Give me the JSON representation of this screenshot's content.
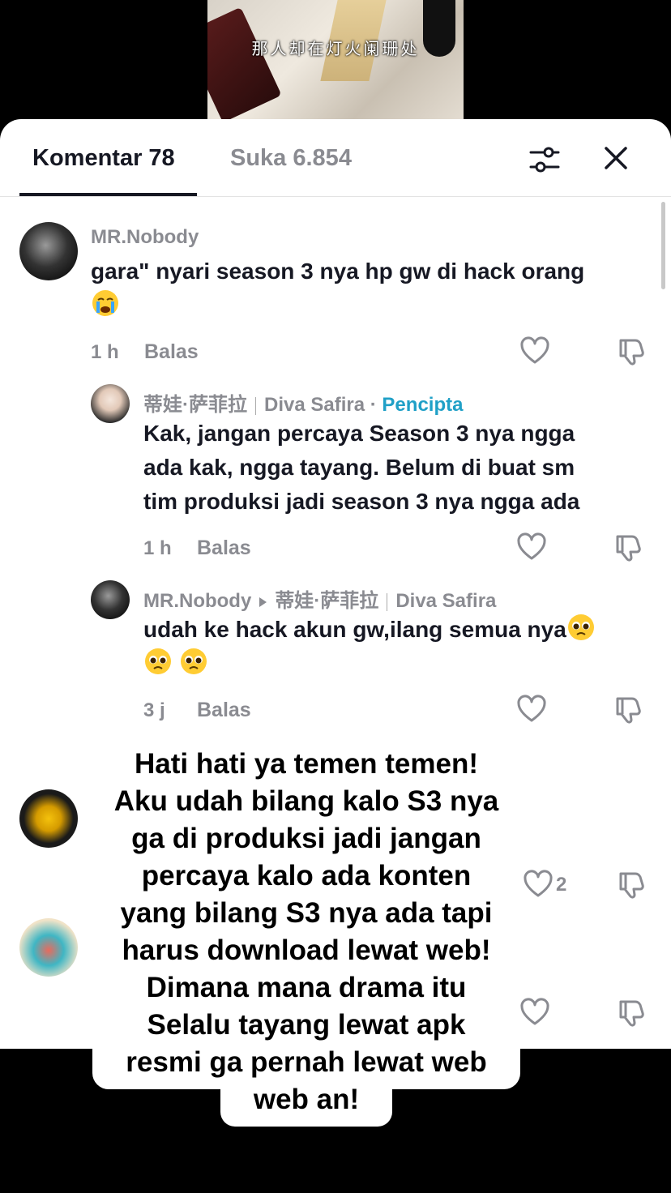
{
  "video": {
    "subtitle": "那人却在灯火阑珊处"
  },
  "tabs": {
    "comments": "Komentar 78",
    "likes": "Suka 6.854"
  },
  "comments": [
    {
      "username": "MR.Nobody",
      "text": "gara\" nyari season 3 nya hp gw di hack orang",
      "time": "1 h",
      "reply": "Balas"
    },
    {
      "username": "蒂娃·萨菲拉",
      "alt_name": "Diva Safira",
      "dot": "·",
      "badge": "Pencipta",
      "text_lines": [
        "Kak, jangan percaya Season 3 nya ngga",
        "ada kak, ngga tayang. Belum di buat sm",
        "tim produksi jadi season 3 nya ngga ada"
      ],
      "time": "1 h",
      "reply": "Balas"
    },
    {
      "username": "MR.Nobody",
      "reply_to": "蒂娃·萨菲拉",
      "reply_to_alt": "Diva Safira",
      "text": "udah ke hack akun gw,ilang semua nya",
      "time": "3 j",
      "reply": "Balas"
    },
    {
      "like_count": "2"
    }
  ],
  "overlay": {
    "lines": [
      "Hati hati ya temen temen!",
      "Aku udah bilang kalo S3 nya",
      "ga di produksi jadi jangan",
      "percaya kalo ada konten",
      "yang bilang S3 nya ada tapi",
      "harus download lewat web!",
      "Dimana mana drama itu",
      "Selalu tayang lewat apk",
      "resmi ga pernah lewat web",
      "web an!"
    ]
  },
  "icons": [
    "filter-icon",
    "close-icon",
    "heart-icon",
    "dislike-icon",
    "pleading-face-emoji",
    "crying-face-emoji"
  ]
}
